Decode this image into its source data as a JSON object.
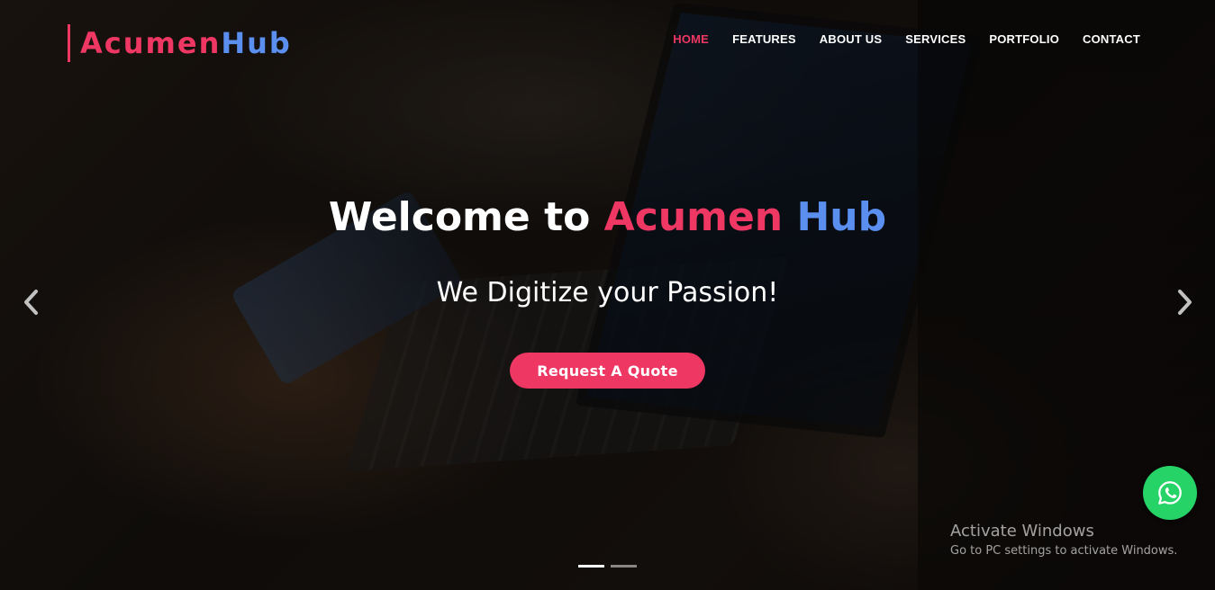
{
  "brand": {
    "logo_part1": "Acumen",
    "logo_part2": "Hub",
    "primary_color": "#ee3763",
    "secondary_color": "#5a8ff0"
  },
  "nav": {
    "items": [
      {
        "label": "HOME",
        "active": true
      },
      {
        "label": "FEATURES",
        "active": false
      },
      {
        "label": "ABOUT US",
        "active": false
      },
      {
        "label": "SERVICES",
        "active": false
      },
      {
        "label": "PORTFOLIO",
        "active": false
      },
      {
        "label": "CONTACT",
        "active": false
      }
    ]
  },
  "hero": {
    "headline_prefix": "Welcome to ",
    "headline_accent1": "Acumen",
    "headline_space": " ",
    "headline_accent2": "Hub",
    "subheadline": "We Digitize your Passion!",
    "cta_label": "Request A Quote"
  },
  "carousel": {
    "prev_icon": "chevron-left-icon",
    "next_icon": "chevron-right-icon",
    "slide_count": 2,
    "active_slide": 1
  },
  "whatsapp": {
    "icon": "whatsapp-icon",
    "color": "#25d366"
  },
  "watermark": {
    "title": "Activate Windows",
    "subtitle": "Go to PC settings to activate Windows."
  }
}
